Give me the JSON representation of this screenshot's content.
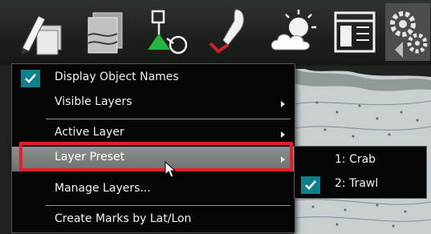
{
  "toolbar": {
    "icons": [
      {
        "name": "edit-route-icon"
      },
      {
        "name": "chart-layers-icon"
      },
      {
        "name": "mark-placement-icon"
      },
      {
        "name": "boat-track-icon"
      },
      {
        "name": "weather-icon"
      },
      {
        "name": "data-panel-icon"
      },
      {
        "name": "settings-gear-icon"
      }
    ]
  },
  "menu": {
    "items": [
      {
        "label": "Display Object Names",
        "checked": true,
        "submenu": false
      },
      {
        "label": "Visible Layers",
        "checked": false,
        "submenu": true
      },
      {
        "label": "Active Layer",
        "checked": false,
        "submenu": true
      },
      {
        "label": "Layer Preset",
        "checked": false,
        "submenu": true,
        "highlighted": true
      },
      {
        "label": "Manage Layers...",
        "checked": false,
        "submenu": false
      },
      {
        "label": "Create Marks by Lat/Lon",
        "checked": false,
        "submenu": false
      }
    ]
  },
  "submenu": {
    "items": [
      {
        "label": "1: Crab",
        "checked": false
      },
      {
        "label": "2: Trawl",
        "checked": true
      }
    ]
  },
  "colors": {
    "check_accent": "#0f7f8b",
    "selection_outline": "#e2202a",
    "menu_bg": "#050505"
  }
}
